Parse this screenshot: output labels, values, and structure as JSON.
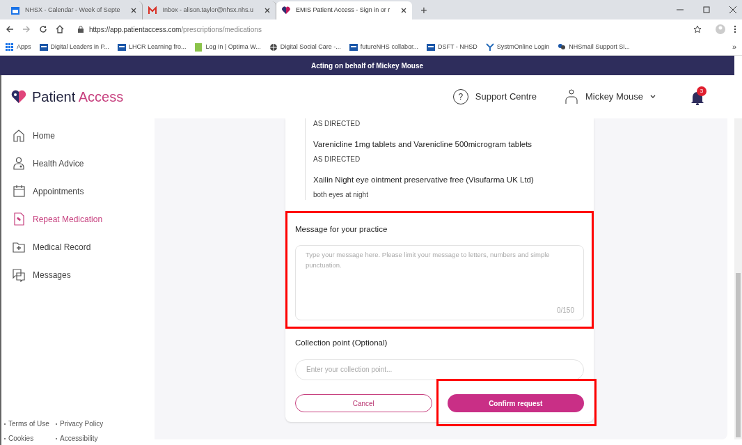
{
  "browser": {
    "tabs": [
      {
        "title": "NHSX - Calendar - Week of Septe",
        "selected": false
      },
      {
        "title": "Inbox - alison.taylor@nhsx.nhs.u",
        "selected": false
      },
      {
        "title": "EMIS Patient Access - Sign in or r",
        "selected": true
      }
    ],
    "new_tab": "+",
    "url_host": "https://app.patientaccess.com",
    "url_path": "/prescriptions/medications",
    "bookmarks": [
      "Apps",
      "Digital Leaders in P...",
      "LHCR Learning fro...",
      "Log In | Optima W...",
      "Digital Social Care -...",
      "futureNHS collabor...",
      "DSFT - NHSD",
      "SystmOnline Login",
      "NHSmail Support Si..."
    ],
    "more": "»"
  },
  "banner": "Acting on behalf of Mickey Mouse",
  "header": {
    "logo_first": "Patient",
    "logo_second": "Access",
    "help_icon": "?",
    "support": "Support Centre",
    "user": "Mickey Mouse",
    "notification_count": "3"
  },
  "sidebar": {
    "items": [
      {
        "label": "Home",
        "selected": false
      },
      {
        "label": "Health Advice",
        "selected": false
      },
      {
        "label": "Appointments",
        "selected": false
      },
      {
        "label": "Repeat Medication",
        "selected": true
      },
      {
        "label": "Medical Record",
        "selected": false
      },
      {
        "label": "Messages",
        "selected": false
      }
    ],
    "footer_links": [
      "Terms of Use",
      "Privacy Policy",
      "Cookies",
      "Accessibility"
    ]
  },
  "medications": [
    {
      "direction": "AS DIRECTED"
    },
    {
      "name": "Varenicline 1mg tablets and Varenicline 500microgram tablets",
      "direction": "AS DIRECTED"
    },
    {
      "name": "Xailin Night eye ointment preservative free (Visufarma UK Ltd)",
      "direction": "both eyes at night"
    }
  ],
  "message": {
    "label": "Message for your practice",
    "placeholder": "Type your message here. Please limit your message to letters, numbers and simple punctuation.",
    "counter": "0/150",
    "highlighted": true
  },
  "collection": {
    "label": "Collection point (Optional)",
    "placeholder": "Enter your collection point..."
  },
  "buttons": [
    {
      "label": "Cancel",
      "kind": "secondary",
      "highlighted": false
    },
    {
      "label": "Confirm request",
      "kind": "primary",
      "highlighted": true
    }
  ]
}
